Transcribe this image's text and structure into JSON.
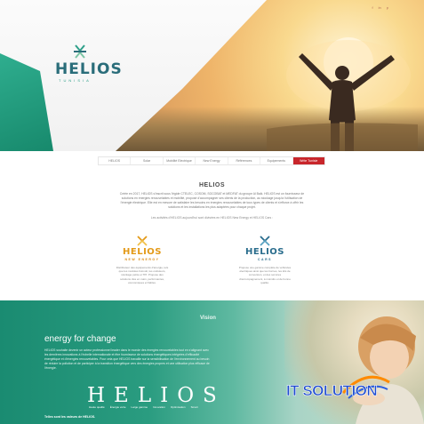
{
  "header": {
    "social": [
      "f",
      "in",
      "p"
    ],
    "logo": {
      "name": "HELIOS",
      "sub": "TUNISIA"
    }
  },
  "nav": {
    "items": [
      "HELIOS",
      "Solar",
      "Mobilité Electrique",
      "New Energy",
      "Références",
      "Equipements",
      "Write Tunisie"
    ],
    "active_index": 6
  },
  "intro": {
    "title": "HELIOS",
    "text": "Créée en 2017, HELIOS s'inscrit sous l'égide CTELEC, COSOM, SOCOBAT et MEDFAT du groupe Al Baik. HELIOS est un fournisseur de solutions en énergies renouvelables et mobilité, proposé d'accompagner ses clients de la production, au stockage jusqu'à l'utilisation de l'énergie électrique. Elle est en mesure de satisfaire les besoins en énergies renouvelables de tous types de clients et s'efforce à offrir les solutions et les installations les plus adaptées pour chaque projet.",
    "note": "Les activités d'HELIOS aujourd'hui sont divisées en HELIOS New Energy et HELIOS Cars :"
  },
  "cards": [
    {
      "name": "HELIOS",
      "sub": "NEW ENERGY",
      "desc": "Distributeur des équipements d'énergie, tels que les modules fotovolt, les onduleurs, stockage petite et TPI. Propose des solutions clés en main, performantes, économiques et fiables."
    },
    {
      "name": "HELIOS",
      "sub": "CARS",
      "desc": "Propose une gamme complète de véhicules électriques ainsi que les bornes, les kits de conversion, et des services d'accompagnement, à moindre et de bonne qualité."
    }
  ],
  "vision": {
    "title": "Vision",
    "subtitle": "energy for change",
    "text": "HELIOS souhaite devenir un acteur professionnel leader dans le monde des énergies renouvelables tout en s'alignant avec les dernières innovations à l'échelle internationale et être fournisseur de solutions énergétiques intégrées d'efficacité énergétique et d'énergies renouvelables. Pour cela que HELIOS travaille sur la sensibilisation de l'environnement au besoin de réduire la pollution et de participer à la transition énergétique vers des énergies propres et une utilisation plus efficace de l'énergie.",
    "brand": "HELIOS",
    "values": [
      "Haute qualité",
      "Énergie verte",
      "Large gamme",
      "Innovation",
      "Optimisation",
      "Smart"
    ],
    "footer": "Telles sont les valeurs de HELIOS."
  },
  "watermark": {
    "text": "IT SOLUTION"
  },
  "colors": {
    "teal": "#1a8b71",
    "accent_red": "#c8262b",
    "logo_blue": "#2a6d7a",
    "energy_orange": "#e39a18",
    "watermark_blue": "#1e4bd0"
  }
}
